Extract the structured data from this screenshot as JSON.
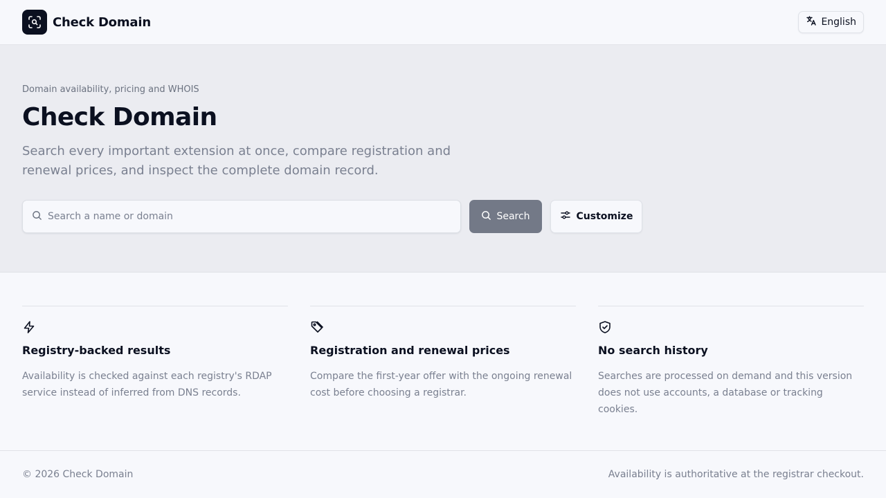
{
  "header": {
    "brand_name": "Check Domain",
    "language_label": "English"
  },
  "hero": {
    "eyebrow": "Domain availability, pricing and WHOIS",
    "title": "Check Domain",
    "subtitle": "Search every important extension at once, compare registration and renewal prices, and inspect the complete domain record.",
    "search_placeholder": "Search a name or domain",
    "search_value": "",
    "search_button": "Search",
    "customize_button": "Customize"
  },
  "features": [
    {
      "icon": "lightning-icon",
      "title": "Registry-backed results",
      "text": "Availability is checked against each registry's RDAP service instead of inferred from DNS records."
    },
    {
      "icon": "tag-icon",
      "title": "Registration and renewal prices",
      "text": "Compare the first-year offer with the ongoing renewal cost before choosing a registrar."
    },
    {
      "icon": "shield-check-icon",
      "title": "No search history",
      "text": "Searches are processed on demand and this version does not use accounts, a database or tracking cookies."
    }
  ],
  "footer": {
    "copyright": "© 2026 Check Domain",
    "note": "Availability is authoritative at the registrar checkout."
  },
  "colors": {
    "brand_dark": "#0b1020",
    "hero_background": "#ebecf1",
    "page_background": "#f7f8fc",
    "search_button": "#737987",
    "muted_text": "#7a8090"
  }
}
